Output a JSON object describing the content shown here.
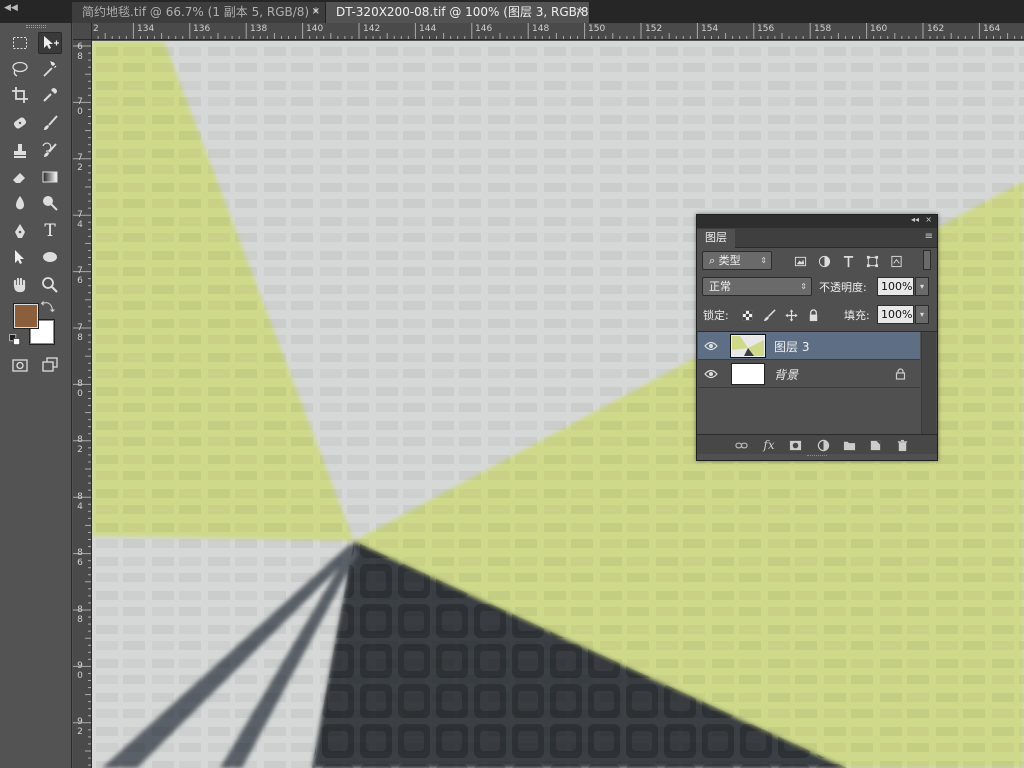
{
  "tabs": [
    {
      "label": "简约地毯.tif @ 66.7% (1 副本 5, RGB/8) *",
      "active": false,
      "close": "×"
    },
    {
      "label": "DT-320X200-08.tif @ 100% (图层 3, RGB/8)",
      "active": true,
      "close": "×"
    }
  ],
  "toolbar": {
    "tools": [
      "rectangular-marquee-icon",
      "move-icon",
      "lasso-icon",
      "magic-wand-icon",
      "crop-icon",
      "eyedropper-icon",
      "healing-brush-icon",
      "brush-icon",
      "clone-stamp-icon",
      "history-brush-icon",
      "eraser-icon",
      "gradient-icon",
      "blur-icon",
      "dodge-icon",
      "pen-icon",
      "type-icon",
      "path-selection-icon",
      "ellipse-icon",
      "hand-icon",
      "zoom-icon"
    ],
    "type_tool_glyph": "T",
    "foreground_color": "#8b5e3c",
    "background_color": "#ffffff"
  },
  "ruler": {
    "top": [
      "2",
      "134",
      "136",
      "138",
      "140",
      "142",
      "144",
      "146",
      "148",
      "150",
      "152",
      "154",
      "156",
      "158",
      "160",
      "162",
      "164"
    ],
    "left": [
      "6\n8",
      "7\n0",
      "7\n2",
      "7\n4",
      "7\n6",
      "7\n8",
      "8\n0",
      "8\n2",
      "8\n4",
      "8\n6",
      "8\n8",
      "9\n0",
      "9\n2"
    ]
  },
  "canvas": {
    "colors": {
      "lime": "#cfd98a",
      "grey": "#d6d8d7",
      "dark": "#3a3f44",
      "dark_stripe": "#5a6168"
    }
  },
  "layers_panel": {
    "title_buttons": {
      "collapse": "◂◂",
      "close": "×"
    },
    "tab": "图层",
    "menu": "≡",
    "filter": {
      "icon": "⌕",
      "value": "类型",
      "arrow": "⇕"
    },
    "filter_icons": [
      "image-filter-icon",
      "adjustment-filter-icon",
      "type-filter-icon",
      "shape-filter-icon",
      "smart-object-filter-icon"
    ],
    "blend_mode": "正常",
    "opacity_label": "不透明度:",
    "opacity_value": "100%",
    "lock_label": "锁定:",
    "fill_label": "填充:",
    "fill_value": "100%",
    "layers": [
      {
        "name": "图层 3",
        "selected": true,
        "italic": false
      },
      {
        "name": "背景",
        "selected": false,
        "italic": true,
        "locked": true
      }
    ],
    "bottom_icons": [
      "link-layers-icon",
      "fx-icon",
      "add-mask-icon",
      "adjustment-layer-icon",
      "new-group-icon",
      "new-layer-icon",
      "trash-icon"
    ],
    "fx_label": "fx"
  }
}
